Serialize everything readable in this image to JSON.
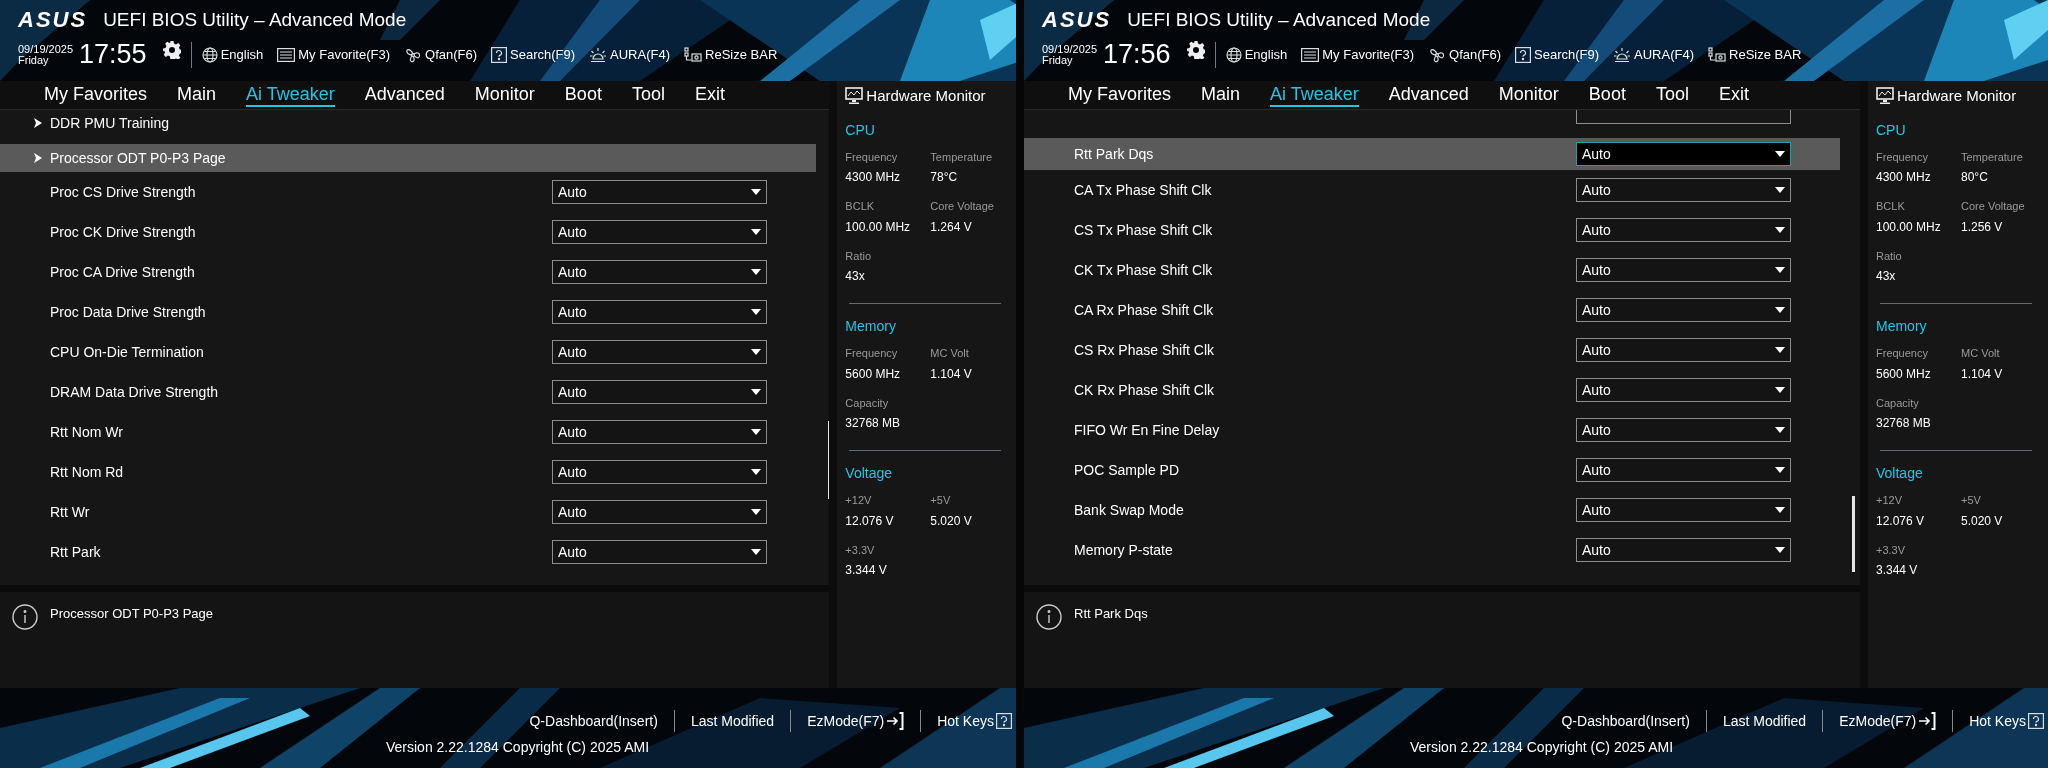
{
  "panels": [
    {
      "header": {
        "logo": "ASUS",
        "title": "UEFI BIOS Utility – Advanced Mode",
        "date": "09/19/2025",
        "day": "Friday",
        "time": "17:55",
        "toolbar": [
          {
            "kind": "globe",
            "label": "English"
          },
          {
            "kind": "list",
            "label": "My Favorite(F3)"
          },
          {
            "kind": "fan",
            "label": "Qfan(F6)"
          },
          {
            "kind": "question",
            "label": "Search(F9)"
          },
          {
            "kind": "light",
            "label": "AURA(F4)"
          },
          {
            "kind": "chip",
            "label": "ReSize BAR"
          }
        ]
      },
      "tabs": [
        {
          "label": "My Favorites",
          "selected": false
        },
        {
          "label": "Main",
          "selected": false
        },
        {
          "label": "Ai Tweaker",
          "selected": true
        },
        {
          "label": "Advanced",
          "selected": false
        },
        {
          "label": "Monitor",
          "selected": false
        },
        {
          "label": "Boot",
          "selected": false
        },
        {
          "label": "Tool",
          "selected": false
        },
        {
          "label": "Exit",
          "selected": false
        }
      ],
      "settings": [
        {
          "kind": "submenu",
          "label": "DDR PMU Training",
          "selected": false
        },
        {
          "kind": "submenu",
          "label": "Processor ODT P0-P3 Page",
          "selected": true
        },
        {
          "kind": "dropdown",
          "label": "Proc CS Drive Strength",
          "value": "Auto",
          "selected": false
        },
        {
          "kind": "dropdown",
          "label": "Proc CK Drive Strength",
          "value": "Auto",
          "selected": false
        },
        {
          "kind": "dropdown",
          "label": "Proc CA Drive Strength",
          "value": "Auto",
          "selected": false
        },
        {
          "kind": "dropdown",
          "label": "Proc Data Drive Strength",
          "value": "Auto",
          "selected": false
        },
        {
          "kind": "dropdown",
          "label": "CPU On-Die Termination",
          "value": "Auto",
          "selected": false
        },
        {
          "kind": "dropdown",
          "label": "DRAM Data Drive Strength",
          "value": "Auto",
          "selected": false
        },
        {
          "kind": "dropdown",
          "label": "Rtt Nom Wr",
          "value": "Auto",
          "selected": false
        },
        {
          "kind": "dropdown",
          "label": "Rtt Nom Rd",
          "value": "Auto",
          "selected": false
        },
        {
          "kind": "dropdown",
          "label": "Rtt Wr",
          "value": "Auto",
          "selected": false
        },
        {
          "kind": "dropdown",
          "label": "Rtt Park",
          "value": "Auto",
          "selected": false
        }
      ],
      "help_text": "Processor ODT P0-P3 Page",
      "hardware_monitor": {
        "title": "Hardware Monitor",
        "sections": [
          {
            "title": "CPU",
            "items": [
              {
                "label": "Frequency",
                "value": "4300 MHz"
              },
              {
                "label": "Temperature",
                "value": "78°C"
              },
              {
                "label": "BCLK",
                "value": "100.00 MHz"
              },
              {
                "label": "Core Voltage",
                "value": "1.264 V"
              },
              {
                "label": "Ratio",
                "value": "43x"
              }
            ]
          },
          {
            "title": "Memory",
            "items": [
              {
                "label": "Frequency",
                "value": "5600 MHz"
              },
              {
                "label": "MC Volt",
                "value": "1.104 V"
              },
              {
                "label": "Capacity",
                "value": "32768 MB"
              }
            ]
          },
          {
            "title": "Voltage",
            "items": [
              {
                "label": "+12V",
                "value": "12.076 V"
              },
              {
                "label": "+5V",
                "value": "5.020 V"
              },
              {
                "label": "+3.3V",
                "value": "3.344 V"
              }
            ]
          }
        ]
      },
      "footer": {
        "links": [
          {
            "kind": "text",
            "label": "Q-Dashboard(Insert)"
          },
          {
            "kind": "text",
            "label": "Last Modified"
          },
          {
            "kind": "exit",
            "label": "EzMode(F7)"
          },
          {
            "kind": "question",
            "label": "Hot Keys"
          }
        ],
        "version": "Version 2.22.1284 Copyright (C) 2025 AMI"
      }
    },
    {
      "header": {
        "logo": "ASUS",
        "title": "UEFI BIOS Utility – Advanced Mode",
        "date": "09/19/2025",
        "day": "Friday",
        "time": "17:56",
        "toolbar": [
          {
            "kind": "globe",
            "label": "English"
          },
          {
            "kind": "list",
            "label": "My Favorite(F3)"
          },
          {
            "kind": "fan",
            "label": "Qfan(F6)"
          },
          {
            "kind": "question",
            "label": "Search(F9)"
          },
          {
            "kind": "light",
            "label": "AURA(F4)"
          },
          {
            "kind": "chip",
            "label": "ReSize BAR"
          }
        ]
      },
      "tabs": [
        {
          "label": "My Favorites",
          "selected": false
        },
        {
          "label": "Main",
          "selected": false
        },
        {
          "label": "Ai Tweaker",
          "selected": true
        },
        {
          "label": "Advanced",
          "selected": false
        },
        {
          "label": "Monitor",
          "selected": false
        },
        {
          "label": "Boot",
          "selected": false
        },
        {
          "label": "Tool",
          "selected": false
        },
        {
          "label": "Exit",
          "selected": false
        }
      ],
      "settings": [
        {
          "kind": "cut"
        },
        {
          "kind": "dropdown",
          "label": "Rtt Park Dqs",
          "value": "Auto",
          "selected": true
        },
        {
          "kind": "dropdown",
          "label": "CA Tx Phase Shift Clk",
          "value": "Auto",
          "selected": false
        },
        {
          "kind": "dropdown",
          "label": "CS Tx Phase Shift Clk",
          "value": "Auto",
          "selected": false
        },
        {
          "kind": "dropdown",
          "label": "CK Tx Phase Shift Clk",
          "value": "Auto",
          "selected": false
        },
        {
          "kind": "dropdown",
          "label": "CA Rx Phase Shift Clk",
          "value": "Auto",
          "selected": false
        },
        {
          "kind": "dropdown",
          "label": "CS Rx Phase Shift Clk",
          "value": "Auto",
          "selected": false
        },
        {
          "kind": "dropdown",
          "label": "CK Rx Phase Shift Clk",
          "value": "Auto",
          "selected": false
        },
        {
          "kind": "dropdown",
          "label": "FIFO Wr En Fine Delay",
          "value": "Auto",
          "selected": false
        },
        {
          "kind": "dropdown",
          "label": "POC Sample PD",
          "value": "Auto",
          "selected": false
        },
        {
          "kind": "dropdown",
          "label": "Bank Swap Mode",
          "value": "Auto",
          "selected": false
        },
        {
          "kind": "dropdown",
          "label": "Memory P-state",
          "value": "Auto",
          "selected": false
        }
      ],
      "help_text": "Rtt Park Dqs",
      "hardware_monitor": {
        "title": "Hardware Monitor",
        "sections": [
          {
            "title": "CPU",
            "items": [
              {
                "label": "Frequency",
                "value": "4300 MHz"
              },
              {
                "label": "Temperature",
                "value": "80°C"
              },
              {
                "label": "BCLK",
                "value": "100.00 MHz"
              },
              {
                "label": "Core Voltage",
                "value": "1.256 V"
              },
              {
                "label": "Ratio",
                "value": "43x"
              }
            ]
          },
          {
            "title": "Memory",
            "items": [
              {
                "label": "Frequency",
                "value": "5600 MHz"
              },
              {
                "label": "MC Volt",
                "value": "1.104 V"
              },
              {
                "label": "Capacity",
                "value": "32768 MB"
              }
            ]
          },
          {
            "title": "Voltage",
            "items": [
              {
                "label": "+12V",
                "value": "12.076 V"
              },
              {
                "label": "+5V",
                "value": "5.020 V"
              },
              {
                "label": "+3.3V",
                "value": "3.344 V"
              }
            ]
          }
        ]
      },
      "footer": {
        "links": [
          {
            "kind": "text",
            "label": "Q-Dashboard(Insert)"
          },
          {
            "kind": "text",
            "label": "Last Modified"
          },
          {
            "kind": "exit",
            "label": "EzMode(F7)"
          },
          {
            "kind": "question",
            "label": "Hot Keys"
          }
        ],
        "version": "Version 2.22.1284 Copyright (C) 2025 AMI"
      }
    }
  ]
}
